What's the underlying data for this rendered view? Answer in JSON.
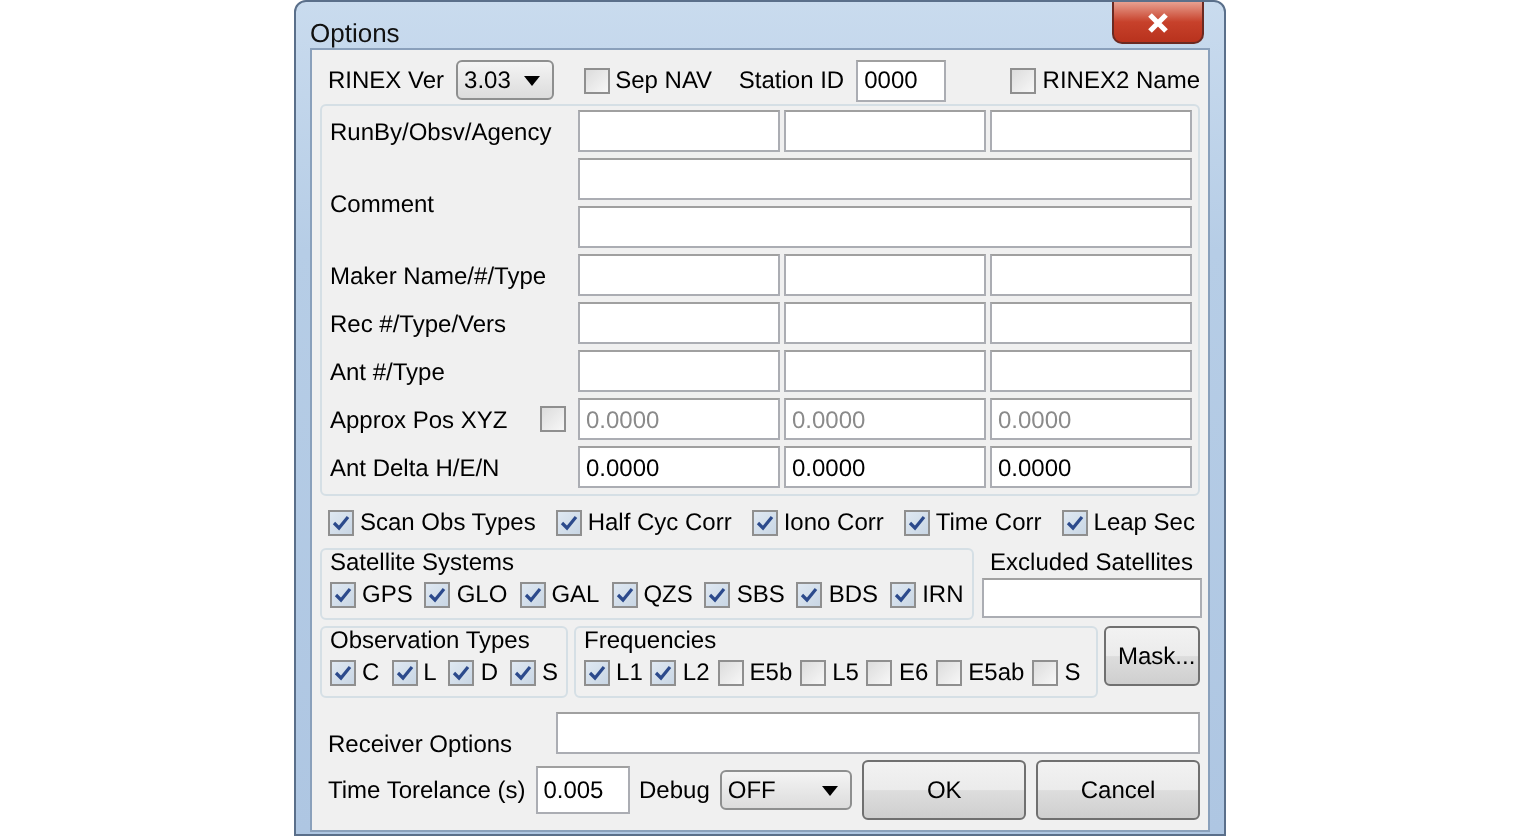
{
  "window": {
    "title": "Options"
  },
  "header": {
    "rinex_ver": {
      "label": "RINEX Ver",
      "value": "3.03"
    },
    "sep_nav": {
      "label": "Sep NAV",
      "checked": false
    },
    "station_id": {
      "label": "Station ID",
      "value": "0000"
    },
    "rinex2_name": {
      "label": "RINEX2 Name",
      "checked": false
    }
  },
  "header_rows": [
    {
      "label": "RunBy/Obsv/Agency",
      "kind": "triple"
    },
    {
      "label": "Comment",
      "kind": "comment"
    },
    {
      "label": "Maker Name/#/Type",
      "kind": "triple"
    },
    {
      "label": "Rec #/Type/Vers",
      "kind": "triple"
    },
    {
      "label": "Ant #/Type",
      "kind": "triple"
    },
    {
      "label": "Approx Pos XYZ",
      "kind": "triple",
      "checked": false,
      "disabled": true,
      "values": [
        "0.0000",
        "0.0000",
        "0.0000"
      ]
    },
    {
      "label": "Ant Delta H/E/N",
      "kind": "triple",
      "values": [
        "0.0000",
        "0.0000",
        "0.0000"
      ]
    }
  ],
  "options": [
    {
      "label": "Scan Obs Types",
      "checked": true
    },
    {
      "label": "Half Cyc Corr",
      "checked": true
    },
    {
      "label": "Iono Corr",
      "checked": true
    },
    {
      "label": "Time Corr",
      "checked": true
    },
    {
      "label": "Leap Sec",
      "checked": true
    }
  ],
  "satellite_systems": {
    "title": "Satellite Systems",
    "items": [
      {
        "label": "GPS",
        "checked": true
      },
      {
        "label": "GLO",
        "checked": true
      },
      {
        "label": "GAL",
        "checked": true
      },
      {
        "label": "QZS",
        "checked": true
      },
      {
        "label": "SBS",
        "checked": true
      },
      {
        "label": "BDS",
        "checked": true
      },
      {
        "label": "IRN",
        "checked": true
      }
    ]
  },
  "excluded_satellites": {
    "label": "Excluded Satellites"
  },
  "observation_types": {
    "title": "Observation Types",
    "items": [
      {
        "label": "C",
        "checked": true
      },
      {
        "label": "L",
        "checked": true
      },
      {
        "label": "D",
        "checked": true
      },
      {
        "label": "S",
        "checked": true
      }
    ]
  },
  "frequencies": {
    "title": "Frequencies",
    "items": [
      {
        "label": "L1",
        "checked": true
      },
      {
        "label": "L2",
        "checked": true
      },
      {
        "label": "E5b",
        "checked": false
      },
      {
        "label": "L5",
        "checked": false
      },
      {
        "label": "E6",
        "checked": false
      },
      {
        "label": "E5ab",
        "checked": false
      },
      {
        "label": "S",
        "checked": false
      }
    ]
  },
  "mask_button": "Mask...",
  "receiver_options": {
    "label": "Receiver Options"
  },
  "time_tolerance": {
    "label": "Time Torelance (s)",
    "value": "0.005"
  },
  "debug": {
    "label": "Debug",
    "value": "OFF"
  },
  "buttons": [
    "OK",
    "Cancel"
  ]
}
